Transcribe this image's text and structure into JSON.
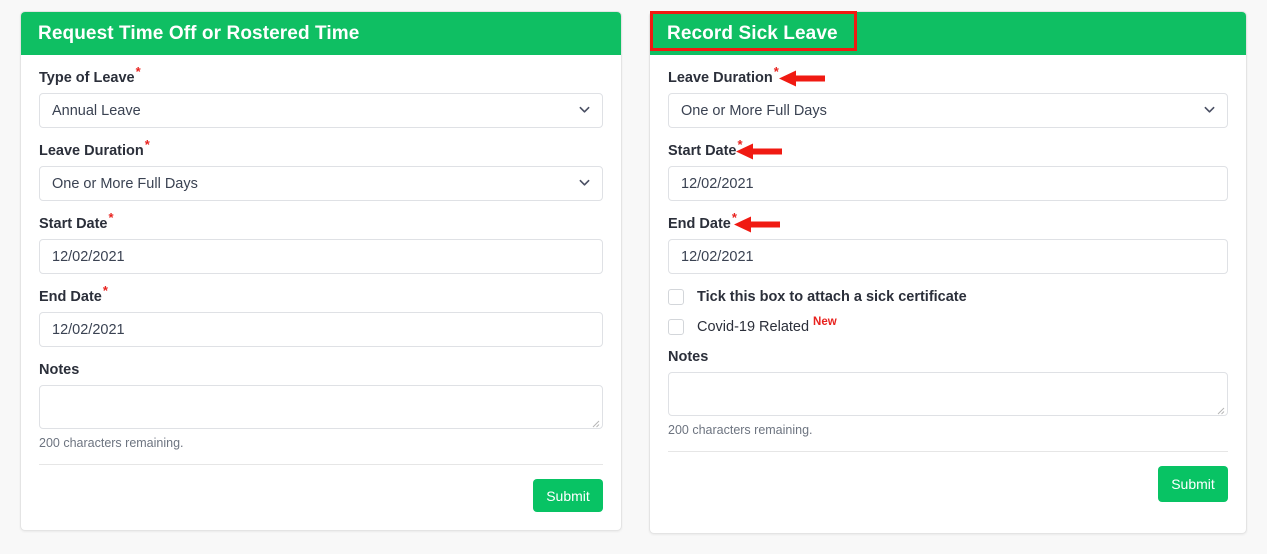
{
  "theme": {
    "header_green": "#0fbf63",
    "submit_green": "#08c364",
    "annotation_red": "#f01a12",
    "required_red": "#e8221e"
  },
  "left_panel": {
    "title": "Request Time Off or Rostered Time",
    "type_of_leave": {
      "label": "Type of Leave",
      "required_marker": "*",
      "value": "Annual Leave",
      "chevron_icon": "chevron-down-icon"
    },
    "leave_duration": {
      "label": "Leave Duration",
      "required_marker": "*",
      "value": "One or More Full Days",
      "chevron_icon": "chevron-down-icon"
    },
    "start_date": {
      "label": "Start Date",
      "required_marker": "*",
      "value": "12/02/2021"
    },
    "end_date": {
      "label": "End Date",
      "required_marker": "*",
      "value": "12/02/2021"
    },
    "notes": {
      "label": "Notes",
      "value": "",
      "counter": "200 characters remaining."
    },
    "submit_label": "Submit"
  },
  "right_panel": {
    "title": "Record Sick Leave",
    "leave_duration": {
      "label": "Leave Duration",
      "required_marker": "*",
      "value": "One or More Full Days",
      "chevron_icon": "chevron-down-icon"
    },
    "start_date": {
      "label": "Start Date",
      "required_marker": "*",
      "value": "12/02/2021"
    },
    "end_date": {
      "label": "End Date",
      "required_marker": "*",
      "value": "12/02/2021"
    },
    "sick_certificate": {
      "label": "Tick this box to attach a sick certificate",
      "checked": false
    },
    "covid_related": {
      "label": "Covid-19 Related",
      "badge": "New",
      "checked": false
    },
    "notes": {
      "label": "Notes",
      "value": "",
      "counter": "200 characters remaining."
    },
    "submit_label": "Submit"
  },
  "annotations": {
    "title_box": "Record Sick Leave",
    "arrows": [
      "arrow-pointing-at-leave-duration",
      "arrow-pointing-at-start-date",
      "arrow-pointing-at-end-date"
    ]
  }
}
